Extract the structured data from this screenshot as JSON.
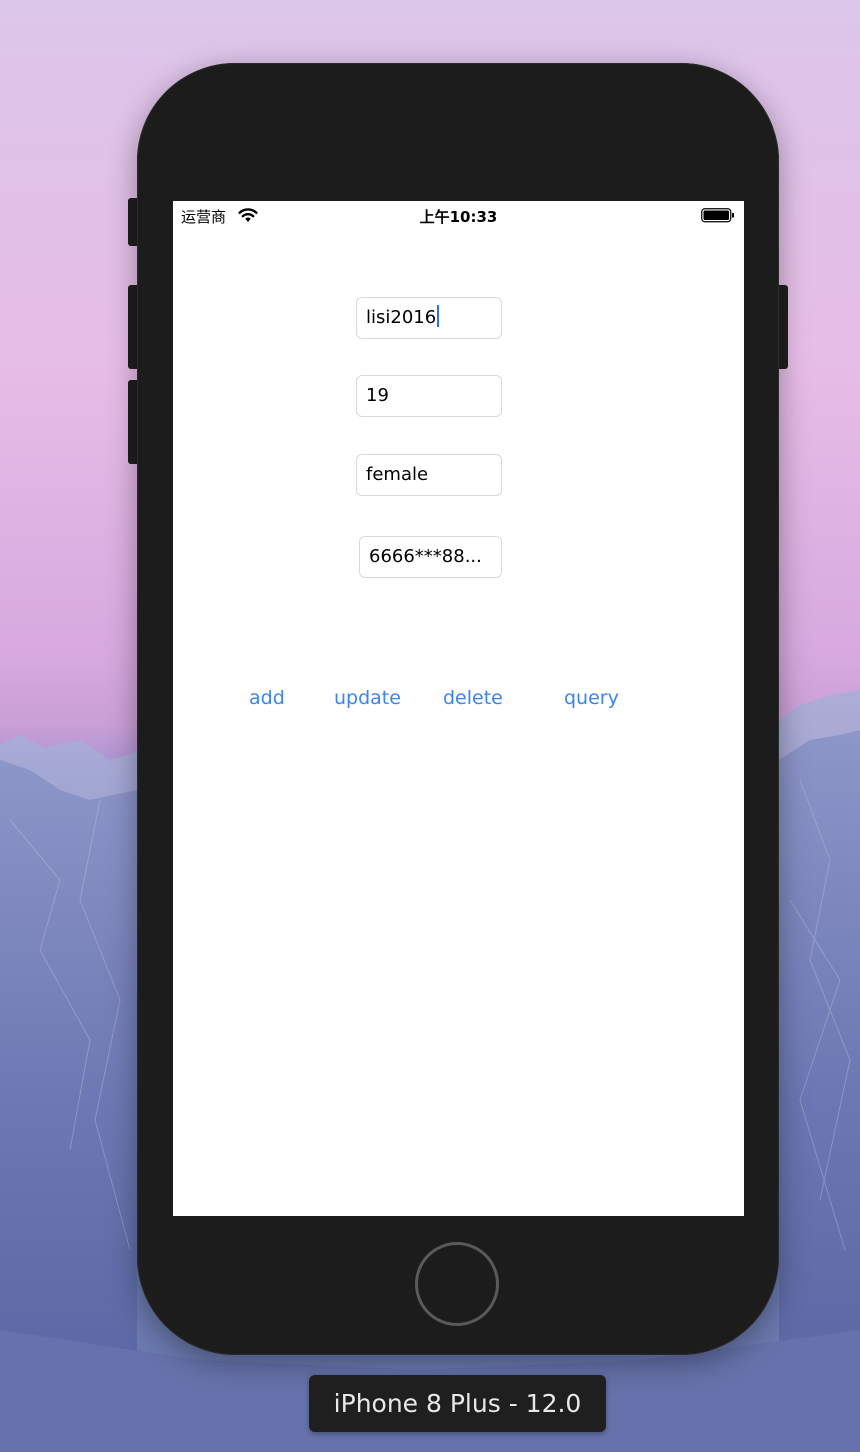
{
  "status_bar": {
    "carrier": "运营商",
    "time": "上午10:33",
    "icons": [
      "wifi-icon",
      "battery-icon"
    ]
  },
  "form": {
    "name_value": "lisi2016",
    "age_value": "19",
    "gender_value": "female",
    "phone_value": "6666***88..."
  },
  "actions": {
    "add_label": "add",
    "update_label": "update",
    "delete_label": "delete",
    "query_label": "query"
  },
  "simulator": {
    "device_label": "iPhone 8 Plus - 12.0"
  },
  "colors": {
    "button_text": "#3a86f0",
    "caret": "#2f6fe0",
    "phone_body": "#1c1c1c"
  }
}
